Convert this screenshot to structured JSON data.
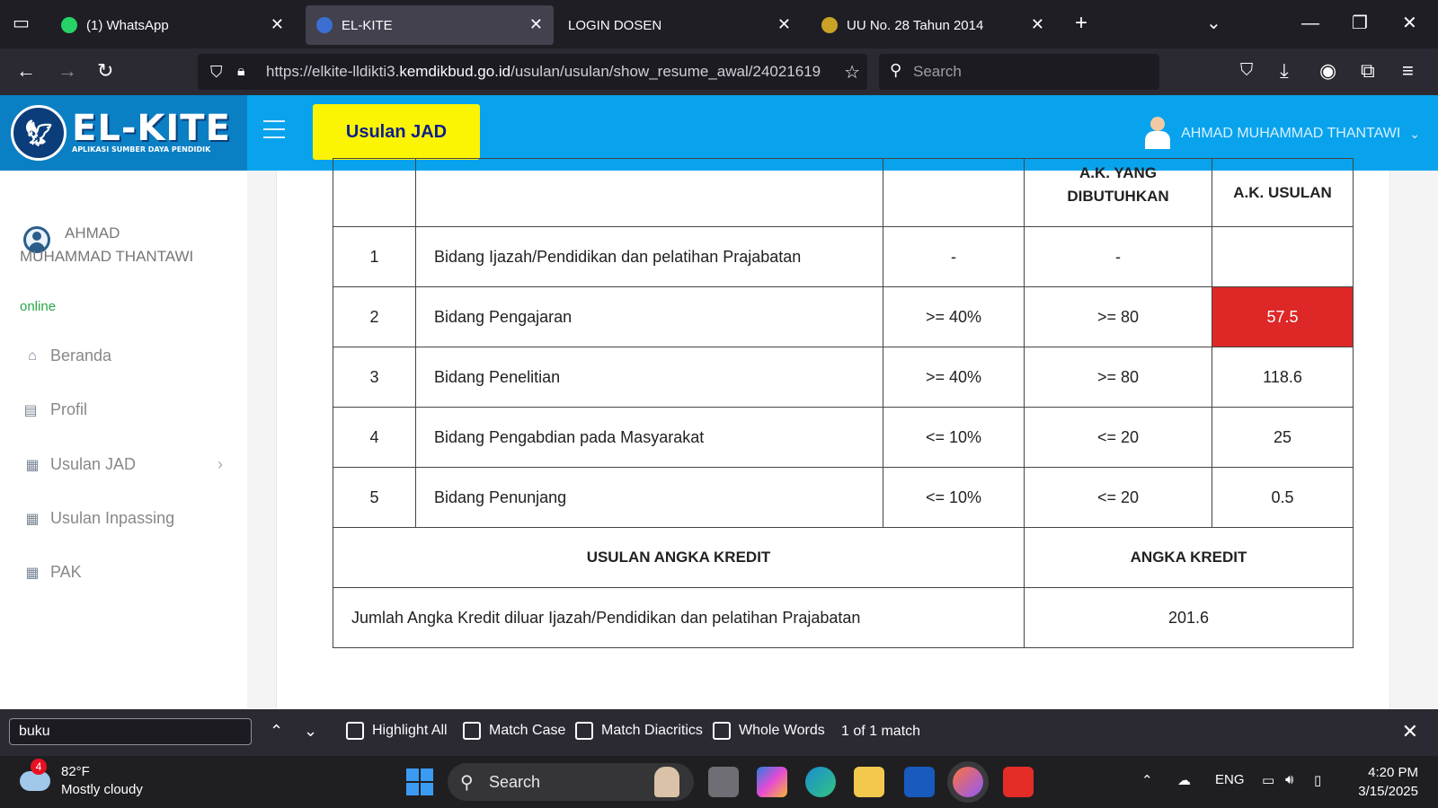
{
  "browser": {
    "tabs": [
      {
        "label": "(1) WhatsApp",
        "active": false
      },
      {
        "label": "EL-KITE",
        "active": true
      },
      {
        "label": "LOGIN DOSEN",
        "active": false
      },
      {
        "label": "UU No. 28 Tahun 2014",
        "active": false
      }
    ],
    "url_prefix": "https://elkite-lldikti3.",
    "url_domain": "kemdikbud.go.id",
    "url_path": "/usulan/usulan/show_resume_awal/24021619",
    "search_placeholder": "Search"
  },
  "header": {
    "logo_title": "EL-KITE",
    "logo_subtitle": "APLIKASI SUMBER DAYA PENDIDIK",
    "usulan_button": "Usulan JAD",
    "user_name": "AHMAD MUHAMMAD THANTAWI",
    "brand_color": "#08a3ec",
    "button_color": "#fbf403"
  },
  "sidebar": {
    "user_name": "AHMAD MUHAMMAD THANTAWI",
    "status": "online",
    "menu": [
      {
        "label": "Beranda",
        "icon": "home-icon"
      },
      {
        "label": "Profil",
        "icon": "id-card-icon"
      },
      {
        "label": "Usulan JAD",
        "icon": "grid-icon",
        "has_children": true
      },
      {
        "label": "Usulan Inpassing",
        "icon": "grid-icon"
      },
      {
        "label": "PAK",
        "icon": "grid-icon"
      }
    ]
  },
  "table": {
    "header": {
      "ak_dibutuhkan": "A.K. YANG DIBUTUHKAN",
      "ak_usulan": "A.K. USULAN"
    },
    "rows": [
      {
        "no": "1",
        "bidang": "Bidang Ijazah/Pendidikan dan pelatihan Prajabatan",
        "persen": "-",
        "dibutuhkan": "-",
        "usulan": "",
        "highlight": false
      },
      {
        "no": "2",
        "bidang": "Bidang Pengajaran",
        "persen": ">= 40%",
        "dibutuhkan": ">= 80",
        "usulan": "57.5",
        "highlight": true
      },
      {
        "no": "3",
        "bidang": "Bidang Penelitian",
        "persen": ">= 40%",
        "dibutuhkan": ">= 80",
        "usulan": "118.6",
        "highlight": false
      },
      {
        "no": "4",
        "bidang": "Bidang Pengabdian pada Masyarakat",
        "persen": "<= 10%",
        "dibutuhkan": "<= 20",
        "usulan": "25",
        "highlight": false
      },
      {
        "no": "5",
        "bidang": "Bidang Penunjang",
        "persen": "<= 10%",
        "dibutuhkan": "<= 20",
        "usulan": "0.5",
        "highlight": false
      }
    ],
    "summary_header_left": "USULAN ANGKA KREDIT",
    "summary_header_right": "ANGKA KREDIT",
    "summary_label": "Jumlah Angka Kredit diluar Ijazah/Pendidikan dan pelatihan Prajabatan",
    "summary_value": "201.6",
    "highlight_color": "#de2727"
  },
  "findbar": {
    "query": "buku",
    "options": [
      "Highlight All",
      "Match Case",
      "Match Diacritics",
      "Whole Words"
    ],
    "status": "1 of 1 match"
  },
  "taskbar": {
    "weather_badge": "4",
    "temperature": "82°F",
    "condition": "Mostly cloudy",
    "search_label": "Search",
    "language": "ENG",
    "time": "4:20 PM",
    "date": "3/15/2025"
  }
}
